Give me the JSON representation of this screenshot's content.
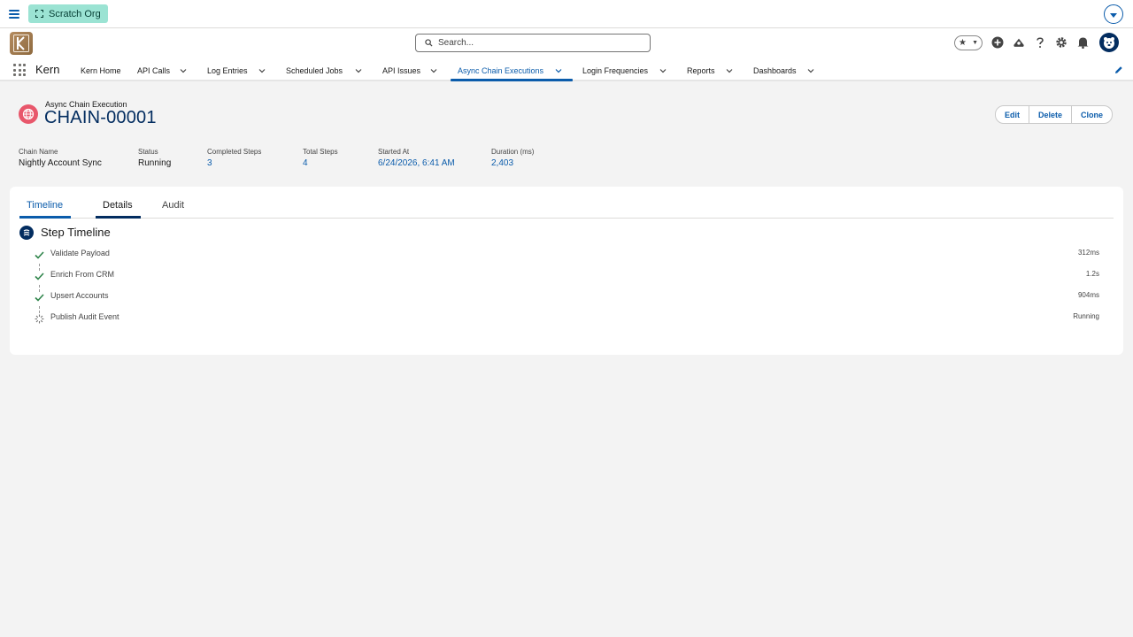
{
  "org": {
    "label": "Scratch Org"
  },
  "search": {
    "placeholder": "Search..."
  },
  "app": {
    "name": "Kern",
    "logo_letter": "K"
  },
  "nav": {
    "tabs": [
      {
        "label": "Kern Home",
        "has_menu": false
      },
      {
        "label": "API Calls",
        "has_menu": true
      },
      {
        "label": "Log Entries",
        "has_menu": true
      },
      {
        "label": "Scheduled Jobs",
        "has_menu": true
      },
      {
        "label": "API Issues",
        "has_menu": true
      },
      {
        "label": "Async Chain Executions",
        "has_menu": true,
        "active": true
      },
      {
        "label": "Login Frequencies",
        "has_menu": true
      },
      {
        "label": "Reports",
        "has_menu": true
      },
      {
        "label": "Dashboards",
        "has_menu": true
      }
    ]
  },
  "record": {
    "object_type": "Async Chain Execution",
    "title": "CHAIN-00001",
    "actions": {
      "edit": "Edit",
      "delete": "Delete",
      "clone": "Clone"
    },
    "fields": [
      {
        "label": "Chain Name",
        "value": "Nightly Account Sync"
      },
      {
        "label": "Status",
        "value": "Running"
      },
      {
        "label": "Completed Steps",
        "value": "3"
      },
      {
        "label": "Total Steps",
        "value": "4"
      },
      {
        "label": "Started At",
        "value": "6/24/2026, 6:41 AM"
      },
      {
        "label": "Duration (ms)",
        "value": "2,403"
      }
    ]
  },
  "content": {
    "tabs": [
      {
        "label": "Timeline",
        "state": "active"
      },
      {
        "label": "Details",
        "state": "selected"
      },
      {
        "label": "Audit",
        "state": "normal"
      }
    ],
    "section_title": "Step Timeline",
    "steps": [
      {
        "name": "Validate Payload",
        "duration": "312ms",
        "status": "completed"
      },
      {
        "name": "Enrich From CRM",
        "duration": "1.2s",
        "status": "completed"
      },
      {
        "name": "Upsert Accounts",
        "duration": "904ms",
        "status": "completed"
      },
      {
        "name": "Publish Audit Event",
        "duration": "Running",
        "status": "running"
      }
    ]
  },
  "colors": {
    "brand": "#0b5cab",
    "navy": "#032d60",
    "org_badge": "#9be3d3",
    "record_icon": "#e8576b",
    "check": "#2e844a"
  }
}
